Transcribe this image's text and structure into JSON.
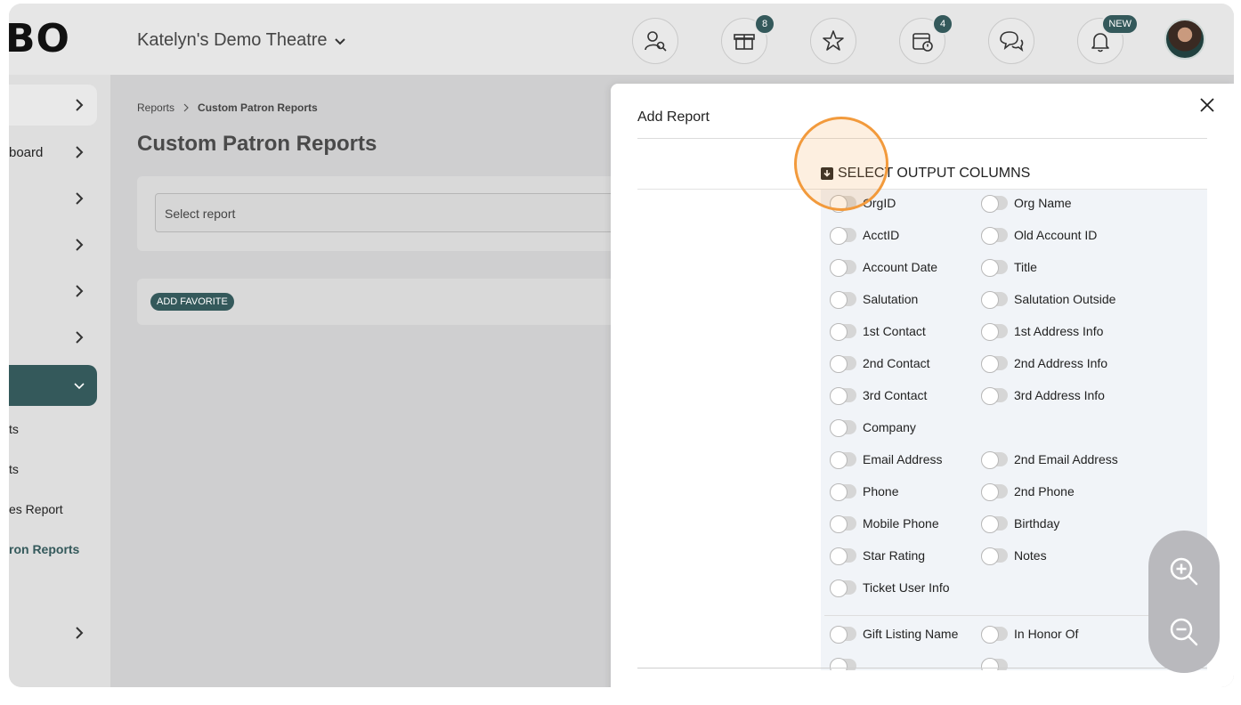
{
  "header": {
    "logo": "BO",
    "venue": "Katelyn's Demo Theatre",
    "icons": [
      {
        "name": "patron-search-icon",
        "badge": ""
      },
      {
        "name": "gift-box-icon",
        "badge": "8"
      },
      {
        "name": "star-icon",
        "badge": ""
      },
      {
        "name": "calendar-alert-icon",
        "badge": "4"
      },
      {
        "name": "chat-help-icon",
        "badge": ""
      },
      {
        "name": "bell-icon",
        "badge": "NEW"
      }
    ]
  },
  "sidebar": {
    "items": [
      "",
      "board",
      "",
      "",
      "",
      "",
      ""
    ],
    "subitems": [
      "ts",
      "ts",
      "es Report",
      "ron Reports"
    ],
    "active_index": 6
  },
  "main": {
    "breadcrumb": {
      "root": "Reports",
      "current": "Custom Patron Reports"
    },
    "title": "Custom Patron Reports",
    "select_placeholder": "Select report",
    "add_favorite": "ADD FAVORITE"
  },
  "modal": {
    "title": "Add Report",
    "section": "SELECT OUTPUT COLUMNS",
    "columns_left": [
      "OrgID",
      "AcctID",
      "Account Date",
      "Salutation",
      "1st Contact",
      "2nd Contact",
      "3rd Contact",
      "Company",
      "Email Address",
      "Phone",
      "Mobile Phone",
      "Star Rating",
      "Ticket User Info",
      "Gift Listing Name"
    ],
    "columns_right": [
      "Org Name",
      "Old Account ID",
      "Title",
      "Salutation Outside",
      "1st Address Info",
      "2nd Address Info",
      "3rd Address Info",
      "",
      "2nd Email Address",
      "2nd Phone",
      "Birthday",
      "Notes",
      "",
      "In Honor Of"
    ]
  },
  "colors": {
    "accent": "#34595b",
    "highlight": "#f29a3c"
  }
}
